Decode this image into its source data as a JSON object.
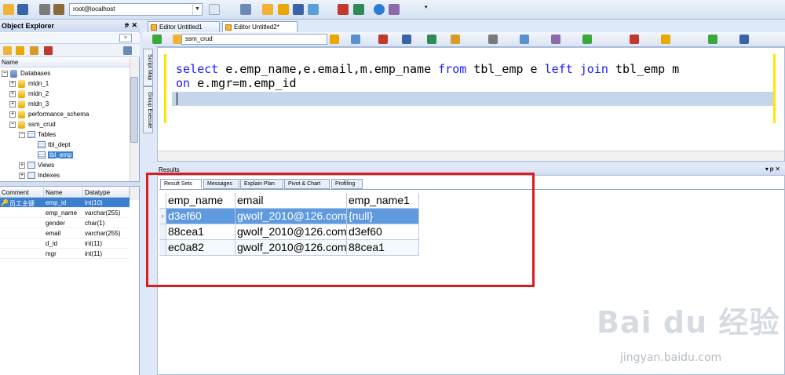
{
  "toolbar": {
    "connection": "root@localhost"
  },
  "object_explorer": {
    "title": "Object Explorer",
    "tree_header": "Name",
    "tree": [
      {
        "label": "Databases",
        "level": 0,
        "kind": "folder"
      },
      {
        "label": "mldn_1",
        "level": 1,
        "kind": "db"
      },
      {
        "label": "mldn_2",
        "level": 1,
        "kind": "db"
      },
      {
        "label": "mldn_3",
        "level": 1,
        "kind": "db"
      },
      {
        "label": "performance_schema",
        "level": 1,
        "kind": "db"
      },
      {
        "label": "ssm_crud",
        "level": 1,
        "kind": "db"
      },
      {
        "label": "Tables",
        "level": 2,
        "kind": "folder"
      },
      {
        "label": "tbl_dept",
        "level": 3,
        "kind": "table"
      },
      {
        "label": "tbl_emp",
        "level": 3,
        "kind": "table",
        "selected": true
      },
      {
        "label": "Views",
        "level": 2,
        "kind": "folder"
      },
      {
        "label": "Indexes",
        "level": 2,
        "kind": "folder"
      }
    ],
    "columns_headers": [
      "Comment",
      "Name",
      "Datatype"
    ],
    "columns": [
      {
        "comment": "员工主键",
        "name": "emp_id",
        "type": "int(10)",
        "key": true
      },
      {
        "comment": "",
        "name": "emp_name",
        "type": "varchar(255)"
      },
      {
        "comment": "",
        "name": "gender",
        "type": "char(1)"
      },
      {
        "comment": "",
        "name": "email",
        "type": "varchar(255)"
      },
      {
        "comment": "",
        "name": "d_id",
        "type": "int(11)"
      },
      {
        "comment": "",
        "name": "mgr",
        "type": "int(11)"
      }
    ]
  },
  "side_tabs": [
    "Script Map",
    "Group Execute"
  ],
  "editor_tabs": [
    "Editor Untitled1",
    "Editor Untitled2*"
  ],
  "editor_db": "ssm_crud",
  "query": {
    "line1": [
      {
        "t": "select",
        "kw": true
      },
      {
        "t": " e.emp_name,e.email,m.emp_name ",
        "kw": false
      },
      {
        "t": "from",
        "kw": true
      },
      {
        "t": " tbl_emp e ",
        "kw": false
      },
      {
        "t": "left",
        "kw": true
      },
      {
        "t": " ",
        "kw": false
      },
      {
        "t": "join",
        "kw": true
      },
      {
        "t": " tbl_emp m",
        "kw": false
      }
    ],
    "line2": [
      {
        "t": "on",
        "kw": true
      },
      {
        "t": " e.mgr=m.emp_id",
        "kw": false
      }
    ]
  },
  "results": {
    "panel_title": "Results",
    "tabs": [
      "Result Sets",
      "Messages",
      "Explain Plan",
      "Pivot & Chart",
      "Profiling"
    ],
    "headers": [
      "emp_name",
      "email",
      "emp_name1"
    ],
    "rows": [
      [
        "d3ef60",
        "gwolf_2010@126.com",
        "{null}"
      ],
      [
        "88cea1",
        "gwolf_2010@126.com",
        "d3ef60"
      ],
      [
        "ec0a82",
        "gwolf_2010@126.com",
        "88cea1"
      ]
    ]
  },
  "watermark": {
    "logo": "Bai du 经验",
    "url": "jingyan.baidu.com"
  }
}
